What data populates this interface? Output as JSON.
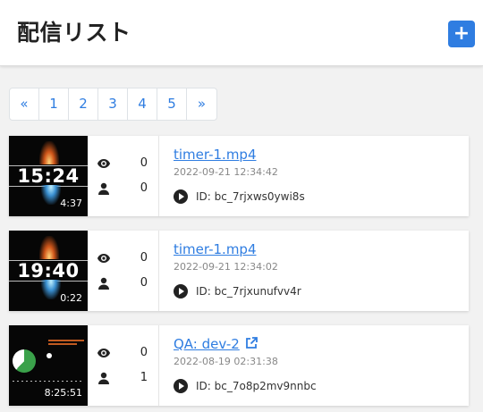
{
  "header": {
    "title": "配信リスト",
    "add_label": "+"
  },
  "pagination": [
    "«",
    "1",
    "2",
    "3",
    "4",
    "5",
    "»"
  ],
  "items": [
    {
      "thumb_time": "15:24",
      "duration": "4:37",
      "views": "0",
      "viewers": "0",
      "filename": "timer-1.mp4",
      "timestamp": "2022-09-21 12:34:42",
      "id": "ID: bc_7rjxws0ywi8s"
    },
    {
      "thumb_time": "19:40",
      "duration": "0:22",
      "views": "0",
      "viewers": "0",
      "filename": "timer-1.mp4",
      "timestamp": "2022-09-21 12:34:02",
      "id": "ID: bc_7rjxunufvv4r"
    },
    {
      "thumb_time": "",
      "duration": "8:25:51",
      "views": "0",
      "viewers": "1",
      "filename": "QA: dev-2",
      "timestamp": "2022-08-19 02:31:38",
      "id": "ID: bc_7o8p2mv9nnbc"
    }
  ],
  "colors": {
    "accent": "#2f7de1",
    "pie_green": "#3aa14a"
  }
}
